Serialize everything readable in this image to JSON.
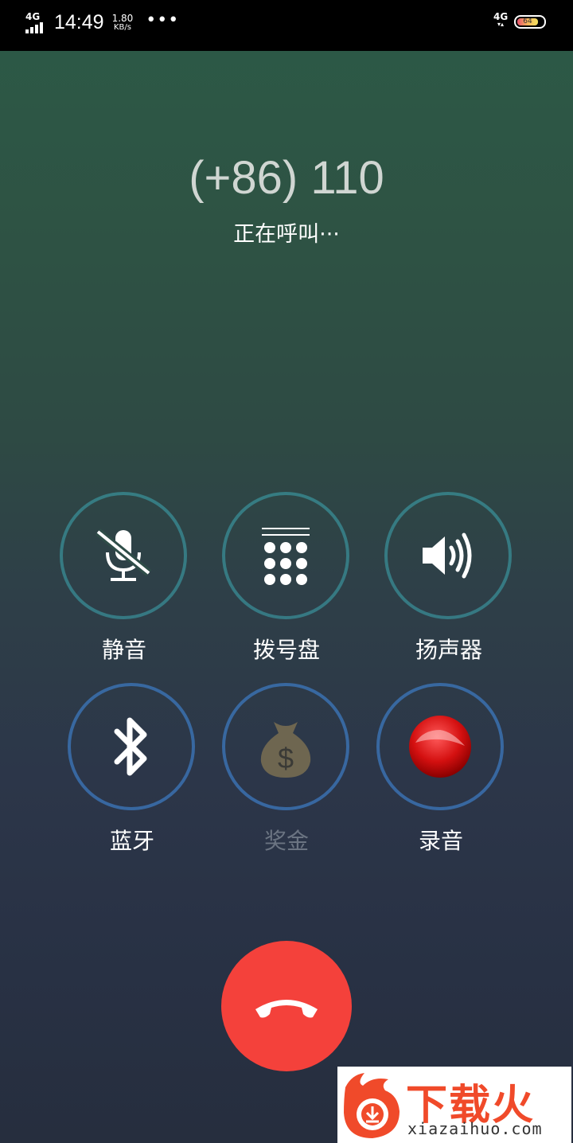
{
  "status_bar": {
    "network_left": "4G",
    "time": "14:49",
    "speed_value": "1.80",
    "speed_unit": "KB/s",
    "more": "•••",
    "network_right": "4G",
    "battery": "64"
  },
  "call": {
    "number": "(+86) 110",
    "status": "正在呼叫···"
  },
  "controls": {
    "mute": "静音",
    "dialpad": "拨号盘",
    "speaker": "扬声器",
    "bluetooth": "蓝牙",
    "bonus": "奖金",
    "record": "录音"
  },
  "watermark": {
    "brand": "下载火",
    "url": "xiazaihuo.com"
  },
  "colors": {
    "hangup": "#f4413b",
    "record": "#d41010",
    "ring_teal": "#3ca0aa",
    "ring_blue": "#3c78be"
  }
}
